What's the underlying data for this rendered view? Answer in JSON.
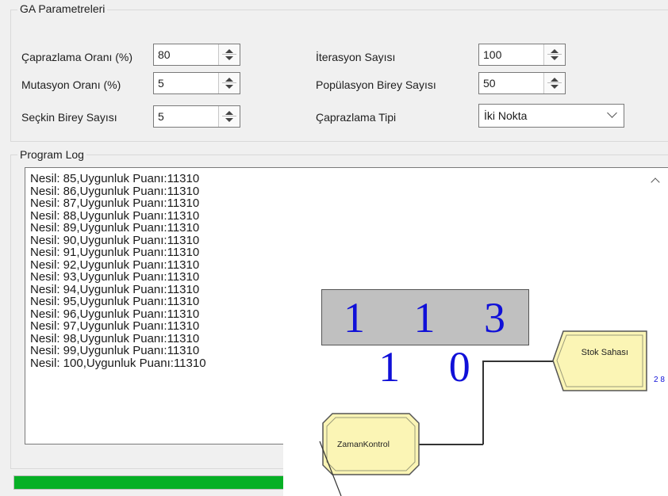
{
  "ga_params": {
    "title": "GA Parametreleri",
    "crossover_rate": {
      "label": "Çaprazlama Oranı (%)",
      "value": "80"
    },
    "mutation_rate": {
      "label": "Mutasyon Oranı (%)",
      "value": "5"
    },
    "elite_count": {
      "label": "Seçkin Birey Sayısı",
      "value": "5"
    },
    "iteration_count": {
      "label": "İterasyon Sayısı",
      "value": "100"
    },
    "population_size": {
      "label": "Popülasyon Birey Sayısı",
      "value": "50"
    },
    "crossover_type": {
      "label": "Çaprazlama Tipi",
      "value": "İki Nokta"
    }
  },
  "program_log": {
    "title": "Program Log",
    "lines": [
      "Nesil: 85,Uygunluk Puanı:11310",
      "Nesil: 86,Uygunluk Puanı:11310",
      "Nesil: 87,Uygunluk Puanı:11310",
      "Nesil: 88,Uygunluk Puanı:11310",
      "Nesil: 89,Uygunluk Puanı:11310",
      "Nesil: 90,Uygunluk Puanı:11310",
      "Nesil: 91,Uygunluk Puanı:11310",
      "Nesil: 92,Uygunluk Puanı:11310",
      "Nesil: 93,Uygunluk Puanı:11310",
      "Nesil: 94,Uygunluk Puanı:11310",
      "Nesil: 95,Uygunluk Puanı:11310",
      "Nesil: 96,Uygunluk Puanı:11310",
      "Nesil: 97,Uygunluk Puanı:11310",
      "Nesil: 98,Uygunluk Puanı:11310",
      "Nesil: 99,Uygunluk Puanı:11310",
      "Nesil: 100,Uygunluk Puanı:11310"
    ]
  },
  "progress": {
    "fraction": 1.0,
    "color": "#06b025"
  },
  "model": {
    "counter_value": "1 1 3 1 0",
    "counter_color": "#1010d8",
    "stock_area_label": "Stok Sahası",
    "stock_area_count": "2 8",
    "time_control_label": "ZamanKontrol",
    "module_fill": "#fbf5b5"
  }
}
